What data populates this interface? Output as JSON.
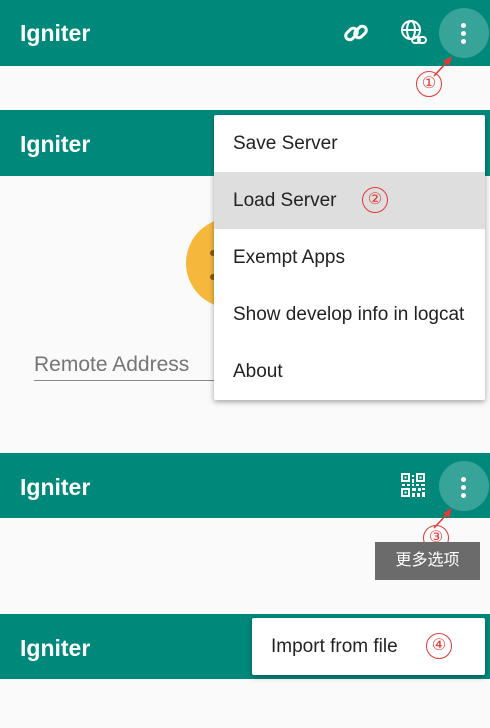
{
  "colors": {
    "appbar": "#00897b",
    "annotation": "#e53935",
    "emoji": "#f5b83d"
  },
  "panel1": {
    "title": "Igniter",
    "icons": [
      "link-icon",
      "globe-link-icon",
      "more-vert-icon"
    ],
    "annotation": "①"
  },
  "panel2": {
    "title": "Igniter",
    "remote_placeholder": "Remote Address",
    "menu": {
      "items": [
        {
          "label": "Save Server"
        },
        {
          "label": "Load Server",
          "annotation": "②"
        },
        {
          "label": "Exempt Apps"
        },
        {
          "label": "Show develop info in logcat"
        },
        {
          "label": "About"
        }
      ]
    }
  },
  "panel3": {
    "title": "Igniter",
    "icons": [
      "qr-code-icon",
      "more-vert-icon"
    ],
    "annotation": "③",
    "tooltip": "更多选项"
  },
  "panel4": {
    "title": "Igniter",
    "menu_item": "Import from file",
    "annotation": "④"
  }
}
